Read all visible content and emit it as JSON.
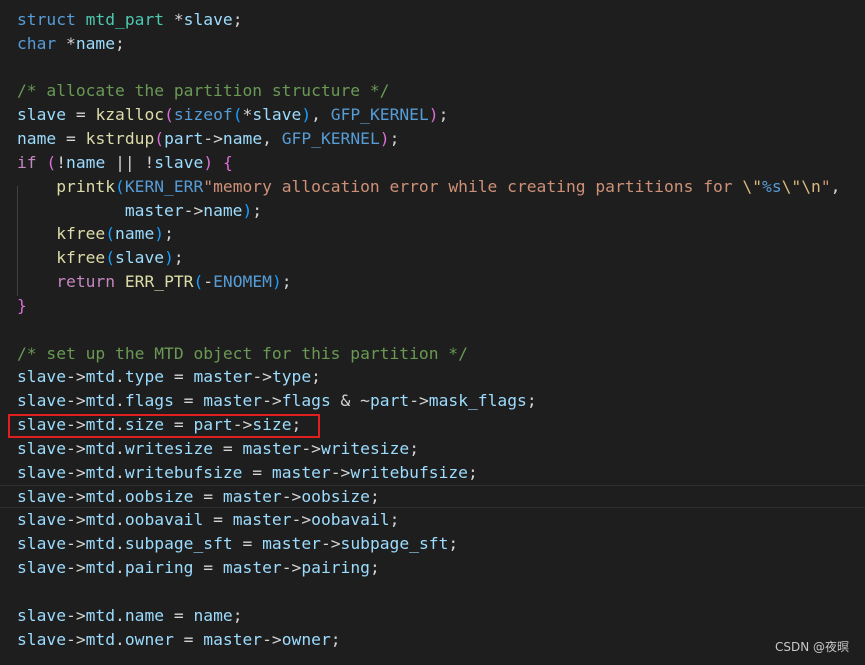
{
  "watermark": "CSDN @夜暝",
  "highlighted_line_index": 17,
  "lines": [
    [
      {
        "t": "struct ",
        "c": "kw"
      },
      {
        "t": "mtd_part ",
        "c": "ty"
      },
      {
        "t": "*",
        "c": "op"
      },
      {
        "t": "slave",
        "c": "var"
      },
      {
        "t": ";",
        "c": "op"
      }
    ],
    [
      {
        "t": "char ",
        "c": "kw"
      },
      {
        "t": "*",
        "c": "op"
      },
      {
        "t": "name",
        "c": "var"
      },
      {
        "t": ";",
        "c": "op"
      }
    ],
    [],
    [
      {
        "t": "/* allocate the partition structure */",
        "c": "cm"
      }
    ],
    [
      {
        "t": "slave",
        "c": "var"
      },
      {
        "t": " = ",
        "c": "op"
      },
      {
        "t": "kzalloc",
        "c": "fn"
      },
      {
        "t": "(",
        "c": "br2"
      },
      {
        "t": "sizeof",
        "c": "kw"
      },
      {
        "t": "(",
        "c": "br3"
      },
      {
        "t": "*",
        "c": "op"
      },
      {
        "t": "slave",
        "c": "var"
      },
      {
        "t": ")",
        "c": "br3"
      },
      {
        "t": ", ",
        "c": "op"
      },
      {
        "t": "GFP_KERNEL",
        "c": "mac"
      },
      {
        "t": ")",
        "c": "br2"
      },
      {
        "t": ";",
        "c": "op"
      }
    ],
    [
      {
        "t": "name",
        "c": "var"
      },
      {
        "t": " = ",
        "c": "op"
      },
      {
        "t": "kstrdup",
        "c": "fn"
      },
      {
        "t": "(",
        "c": "br2"
      },
      {
        "t": "part",
        "c": "var"
      },
      {
        "t": "->",
        "c": "op"
      },
      {
        "t": "name",
        "c": "var"
      },
      {
        "t": ", ",
        "c": "op"
      },
      {
        "t": "GFP_KERNEL",
        "c": "mac"
      },
      {
        "t": ")",
        "c": "br2"
      },
      {
        "t": ";",
        "c": "op"
      }
    ],
    [
      {
        "t": "if",
        "c": "ctl"
      },
      {
        "t": " ",
        "c": "op"
      },
      {
        "t": "(",
        "c": "br2"
      },
      {
        "t": "!",
        "c": "op"
      },
      {
        "t": "name",
        "c": "var"
      },
      {
        "t": " || ",
        "c": "op"
      },
      {
        "t": "!",
        "c": "op"
      },
      {
        "t": "slave",
        "c": "var"
      },
      {
        "t": ")",
        "c": "br2"
      },
      {
        "t": " ",
        "c": "op"
      },
      {
        "t": "{",
        "c": "br2"
      }
    ],
    [
      {
        "t": "    ",
        "c": "op"
      },
      {
        "t": "printk",
        "c": "fn"
      },
      {
        "t": "(",
        "c": "br3"
      },
      {
        "t": "KERN_ERR",
        "c": "mac"
      },
      {
        "t": "\"memory allocation error while creating partitions for ",
        "c": "str"
      },
      {
        "t": "\\\"",
        "c": "esc"
      },
      {
        "t": "%s",
        "c": "kw"
      },
      {
        "t": "\\\"",
        "c": "esc"
      },
      {
        "t": "\\n",
        "c": "esc"
      },
      {
        "t": "\"",
        "c": "str"
      },
      {
        "t": ",",
        "c": "op"
      }
    ],
    [
      {
        "t": "           ",
        "c": "op"
      },
      {
        "t": "master",
        "c": "var"
      },
      {
        "t": "->",
        "c": "op"
      },
      {
        "t": "name",
        "c": "var"
      },
      {
        "t": ")",
        "c": "br3"
      },
      {
        "t": ";",
        "c": "op"
      }
    ],
    [
      {
        "t": "    ",
        "c": "op"
      },
      {
        "t": "kfree",
        "c": "fn"
      },
      {
        "t": "(",
        "c": "br3"
      },
      {
        "t": "name",
        "c": "var"
      },
      {
        "t": ")",
        "c": "br3"
      },
      {
        "t": ";",
        "c": "op"
      }
    ],
    [
      {
        "t": "    ",
        "c": "op"
      },
      {
        "t": "kfree",
        "c": "fn"
      },
      {
        "t": "(",
        "c": "br3"
      },
      {
        "t": "slave",
        "c": "var"
      },
      {
        "t": ")",
        "c": "br3"
      },
      {
        "t": ";",
        "c": "op"
      }
    ],
    [
      {
        "t": "    ",
        "c": "op"
      },
      {
        "t": "return",
        "c": "ctl"
      },
      {
        "t": " ",
        "c": "op"
      },
      {
        "t": "ERR_PTR",
        "c": "fn"
      },
      {
        "t": "(",
        "c": "br3"
      },
      {
        "t": "-",
        "c": "op"
      },
      {
        "t": "ENOMEM",
        "c": "mac"
      },
      {
        "t": ")",
        "c": "br3"
      },
      {
        "t": ";",
        "c": "op"
      }
    ],
    [
      {
        "t": "}",
        "c": "br2"
      }
    ],
    [],
    [
      {
        "t": "/* set up the MTD object for this partition */",
        "c": "cm"
      }
    ],
    [
      {
        "t": "slave",
        "c": "var"
      },
      {
        "t": "->",
        "c": "op"
      },
      {
        "t": "mtd",
        "c": "var"
      },
      {
        "t": ".",
        "c": "op"
      },
      {
        "t": "type",
        "c": "var"
      },
      {
        "t": " = ",
        "c": "op"
      },
      {
        "t": "master",
        "c": "var"
      },
      {
        "t": "->",
        "c": "op"
      },
      {
        "t": "type",
        "c": "var"
      },
      {
        "t": ";",
        "c": "op"
      }
    ],
    [
      {
        "t": "slave",
        "c": "var"
      },
      {
        "t": "->",
        "c": "op"
      },
      {
        "t": "mtd",
        "c": "var"
      },
      {
        "t": ".",
        "c": "op"
      },
      {
        "t": "flags",
        "c": "var"
      },
      {
        "t": " = ",
        "c": "op"
      },
      {
        "t": "master",
        "c": "var"
      },
      {
        "t": "->",
        "c": "op"
      },
      {
        "t": "flags",
        "c": "var"
      },
      {
        "t": " & ~",
        "c": "op"
      },
      {
        "t": "part",
        "c": "var"
      },
      {
        "t": "->",
        "c": "op"
      },
      {
        "t": "mask_flags",
        "c": "var"
      },
      {
        "t": ";",
        "c": "op"
      }
    ],
    [
      {
        "t": "slave",
        "c": "var"
      },
      {
        "t": "->",
        "c": "op"
      },
      {
        "t": "mtd",
        "c": "var"
      },
      {
        "t": ".",
        "c": "op"
      },
      {
        "t": "size",
        "c": "var"
      },
      {
        "t": " = ",
        "c": "op"
      },
      {
        "t": "part",
        "c": "var"
      },
      {
        "t": "->",
        "c": "op"
      },
      {
        "t": "size",
        "c": "var"
      },
      {
        "t": ";",
        "c": "op"
      }
    ],
    [
      {
        "t": "slave",
        "c": "var"
      },
      {
        "t": "->",
        "c": "op"
      },
      {
        "t": "mtd",
        "c": "var"
      },
      {
        "t": ".",
        "c": "op"
      },
      {
        "t": "writesize",
        "c": "var"
      },
      {
        "t": " = ",
        "c": "op"
      },
      {
        "t": "master",
        "c": "var"
      },
      {
        "t": "->",
        "c": "op"
      },
      {
        "t": "writesize",
        "c": "var"
      },
      {
        "t": ";",
        "c": "op"
      }
    ],
    [
      {
        "t": "slave",
        "c": "var"
      },
      {
        "t": "->",
        "c": "op"
      },
      {
        "t": "mtd",
        "c": "var"
      },
      {
        "t": ".",
        "c": "op"
      },
      {
        "t": "writebufsize",
        "c": "var"
      },
      {
        "t": " = ",
        "c": "op"
      },
      {
        "t": "master",
        "c": "var"
      },
      {
        "t": "->",
        "c": "op"
      },
      {
        "t": "writebufsize",
        "c": "var"
      },
      {
        "t": ";",
        "c": "op"
      }
    ],
    [
      {
        "t": "slave",
        "c": "var"
      },
      {
        "t": "->",
        "c": "op"
      },
      {
        "t": "mtd",
        "c": "var"
      },
      {
        "t": ".",
        "c": "op"
      },
      {
        "t": "oobsize",
        "c": "var"
      },
      {
        "t": " = ",
        "c": "op"
      },
      {
        "t": "master",
        "c": "var"
      },
      {
        "t": "->",
        "c": "op"
      },
      {
        "t": "oobsize",
        "c": "var"
      },
      {
        "t": ";",
        "c": "op"
      }
    ],
    [
      {
        "t": "slave",
        "c": "var"
      },
      {
        "t": "->",
        "c": "op"
      },
      {
        "t": "mtd",
        "c": "var"
      },
      {
        "t": ".",
        "c": "op"
      },
      {
        "t": "oobavail",
        "c": "var"
      },
      {
        "t": " = ",
        "c": "op"
      },
      {
        "t": "master",
        "c": "var"
      },
      {
        "t": "->",
        "c": "op"
      },
      {
        "t": "oobavail",
        "c": "var"
      },
      {
        "t": ";",
        "c": "op"
      }
    ],
    [
      {
        "t": "slave",
        "c": "var"
      },
      {
        "t": "->",
        "c": "op"
      },
      {
        "t": "mtd",
        "c": "var"
      },
      {
        "t": ".",
        "c": "op"
      },
      {
        "t": "subpage_sft",
        "c": "var"
      },
      {
        "t": " = ",
        "c": "op"
      },
      {
        "t": "master",
        "c": "var"
      },
      {
        "t": "->",
        "c": "op"
      },
      {
        "t": "subpage_sft",
        "c": "var"
      },
      {
        "t": ";",
        "c": "op"
      }
    ],
    [
      {
        "t": "slave",
        "c": "var"
      },
      {
        "t": "->",
        "c": "op"
      },
      {
        "t": "mtd",
        "c": "var"
      },
      {
        "t": ".",
        "c": "op"
      },
      {
        "t": "pairing",
        "c": "var"
      },
      {
        "t": " = ",
        "c": "op"
      },
      {
        "t": "master",
        "c": "var"
      },
      {
        "t": "->",
        "c": "op"
      },
      {
        "t": "pairing",
        "c": "var"
      },
      {
        "t": ";",
        "c": "op"
      }
    ],
    [],
    [
      {
        "t": "slave",
        "c": "var"
      },
      {
        "t": "->",
        "c": "op"
      },
      {
        "t": "mtd",
        "c": "var"
      },
      {
        "t": ".",
        "c": "op"
      },
      {
        "t": "name",
        "c": "var"
      },
      {
        "t": " = ",
        "c": "op"
      },
      {
        "t": "name",
        "c": "var"
      },
      {
        "t": ";",
        "c": "op"
      }
    ],
    [
      {
        "t": "slave",
        "c": "var"
      },
      {
        "t": "->",
        "c": "op"
      },
      {
        "t": "mtd",
        "c": "var"
      },
      {
        "t": ".",
        "c": "op"
      },
      {
        "t": "owner",
        "c": "var"
      },
      {
        "t": " = ",
        "c": "op"
      },
      {
        "t": "master",
        "c": "var"
      },
      {
        "t": "->",
        "c": "op"
      },
      {
        "t": "owner",
        "c": "var"
      },
      {
        "t": ";",
        "c": "op"
      }
    ]
  ]
}
